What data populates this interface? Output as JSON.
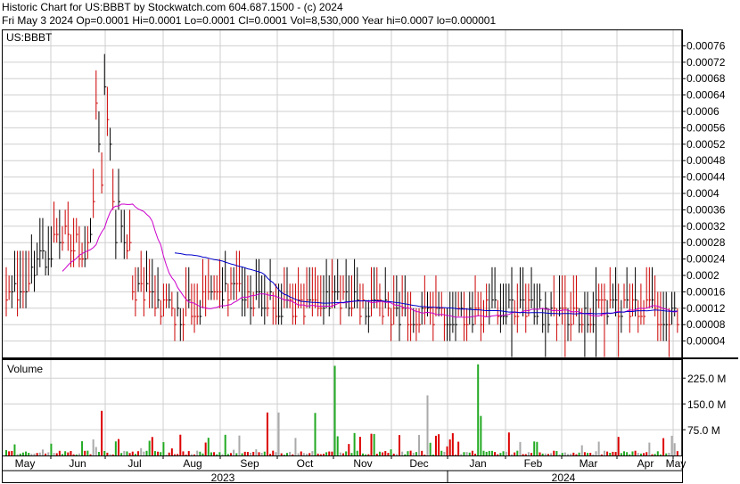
{
  "header": {
    "line1": "Historic Chart for US:BBBT by Stockwatch.com 604.687.1500 - (c) 2024",
    "line2": "Fri May  3 2024  Op=0.0001  Hi=0.0001  Lo=0.0001  Cl=0.0001  Vol=8,530,000  Year hi=0.0007  lo=0.000001"
  },
  "colors": {
    "background": "#ffffff",
    "grid": "#cfcfcf",
    "price_up": "#000000",
    "price_down": "#cc0000",
    "ma_short": "#cc00cc",
    "ma_long": "#0000cc",
    "vol_up": "#22aa22",
    "vol_down": "#dd0000",
    "vol_flat": "#aaaaaa"
  },
  "chart_data": [
    {
      "type": "ohlc",
      "title": "US:BBBT",
      "ylim": [
        0,
        0.0008
      ],
      "y_ticks": [
        "0.00076",
        "0.00072",
        "0.00068",
        "0.00064",
        "0.0006",
        "0.00056",
        "0.00052",
        "0.00048",
        "0.00044",
        "0.0004",
        "0.00036",
        "0.00032",
        "0.00028",
        "0.00024",
        "0.0002",
        "0.00016",
        "0.00012",
        "0.00008",
        "0.00004"
      ],
      "grid": true,
      "series": [
        {
          "values_by_month": [
            {
              "month": "May",
              "close": 0.00013
            },
            {
              "month": "Jun",
              "close": 0.0003
            },
            {
              "month": "Jul",
              "close": 0.0002
            },
            {
              "month": "Aug",
              "close": 0.0001
            },
            {
              "month": "Sep",
              "close": 0.00016
            },
            {
              "month": "Oct",
              "close": 0.00012
            },
            {
              "month": "Nov",
              "close": 0.00014
            },
            {
              "month": "Dec",
              "close": 0.0001
            },
            {
              "month": "Jan",
              "close": 0.0001
            },
            {
              "month": "Feb",
              "close": 0.00012
            },
            {
              "month": "Mar",
              "close": 0.0001
            },
            {
              "month": "Apr",
              "close": 0.00012
            },
            {
              "month": "May",
              "close": 0.0001
            }
          ]
        }
      ]
    },
    {
      "type": "bar",
      "title": "Volume",
      "ylim": [
        0,
        280000000
      ],
      "y_ticks": [
        "225.0 M",
        "150.0 M",
        "75.0 M"
      ],
      "grid": true,
      "x_labels": [
        "May",
        "Jun",
        "Jul",
        "Aug",
        "Sep",
        "Oct",
        "Nov",
        "Dec",
        "Jan",
        "Feb",
        "Mar",
        "Apr",
        "May"
      ],
      "years": [
        "2023",
        "2024"
      ]
    }
  ]
}
